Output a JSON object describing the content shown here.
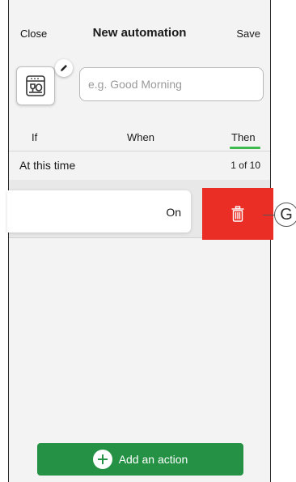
{
  "header": {
    "close_label": "Close",
    "title": "New automation",
    "save_label": "Save"
  },
  "automation": {
    "icon": "dishwasher-icon",
    "name_placeholder": "e.g. Good Morning",
    "name_value": ""
  },
  "tabs": [
    {
      "label": "If",
      "active": false
    },
    {
      "label": "When",
      "active": false
    },
    {
      "label": "Then",
      "active": true
    }
  ],
  "section": {
    "title": "At this time",
    "count": "1 of 10"
  },
  "action": {
    "value": "On",
    "delete_icon": "trash-icon"
  },
  "marker": "G",
  "footer": {
    "add_label": "Add an action"
  },
  "colors": {
    "accent": "#3dbb4e",
    "primary_button": "#259144",
    "delete": "#ea2e26",
    "background": "#f3f3f3"
  }
}
